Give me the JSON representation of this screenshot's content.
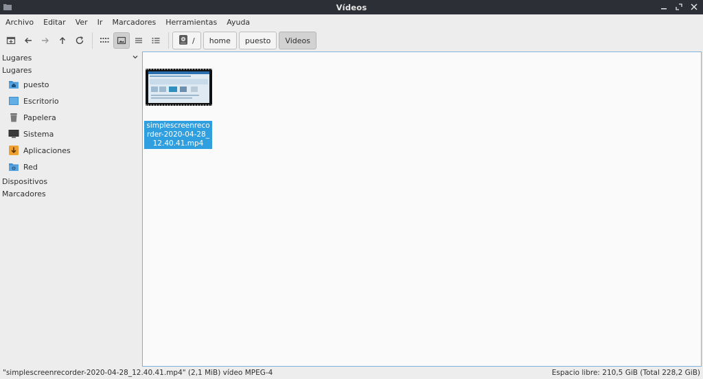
{
  "window": {
    "title": "Vídeos"
  },
  "menu": [
    "Archivo",
    "Editar",
    "Ver",
    "Ir",
    "Marcadores",
    "Herramientas",
    "Ayuda"
  ],
  "breadcrumb": [
    {
      "label": "/",
      "icon": "disk-icon"
    },
    {
      "label": "home"
    },
    {
      "label": "puesto"
    },
    {
      "label": "Videos"
    }
  ],
  "sidebar": {
    "header": "Lugares",
    "section_places": "Lugares",
    "items": [
      {
        "label": "puesto",
        "icon": "home-folder-icon"
      },
      {
        "label": "Escritorio",
        "icon": "desktop-icon"
      },
      {
        "label": "Papelera",
        "icon": "trash-icon"
      },
      {
        "label": "Sistema",
        "icon": "system-monitor-icon"
      },
      {
        "label": "Aplicaciones",
        "icon": "applications-icon"
      },
      {
        "label": "Red",
        "icon": "network-folder-icon"
      }
    ],
    "section_devices": "Dispositivos",
    "section_bookmarks": "Marcadores"
  },
  "files": [
    {
      "name": "simplescreenrecorder-2020-04-28_12.40.41.mp4"
    }
  ],
  "status": {
    "left": "\"simplescreenrecorder-2020-04-28_12.40.41.mp4\" (2,1 MiB) vídeo MPEG-4",
    "right": "Espacio libre: 210,5 GiB (Total 228,2 GiB)"
  },
  "colors": {
    "selection": "#2f9fe0",
    "titlebar": "#2d2f36",
    "focus_border": "#7fb0dc"
  }
}
